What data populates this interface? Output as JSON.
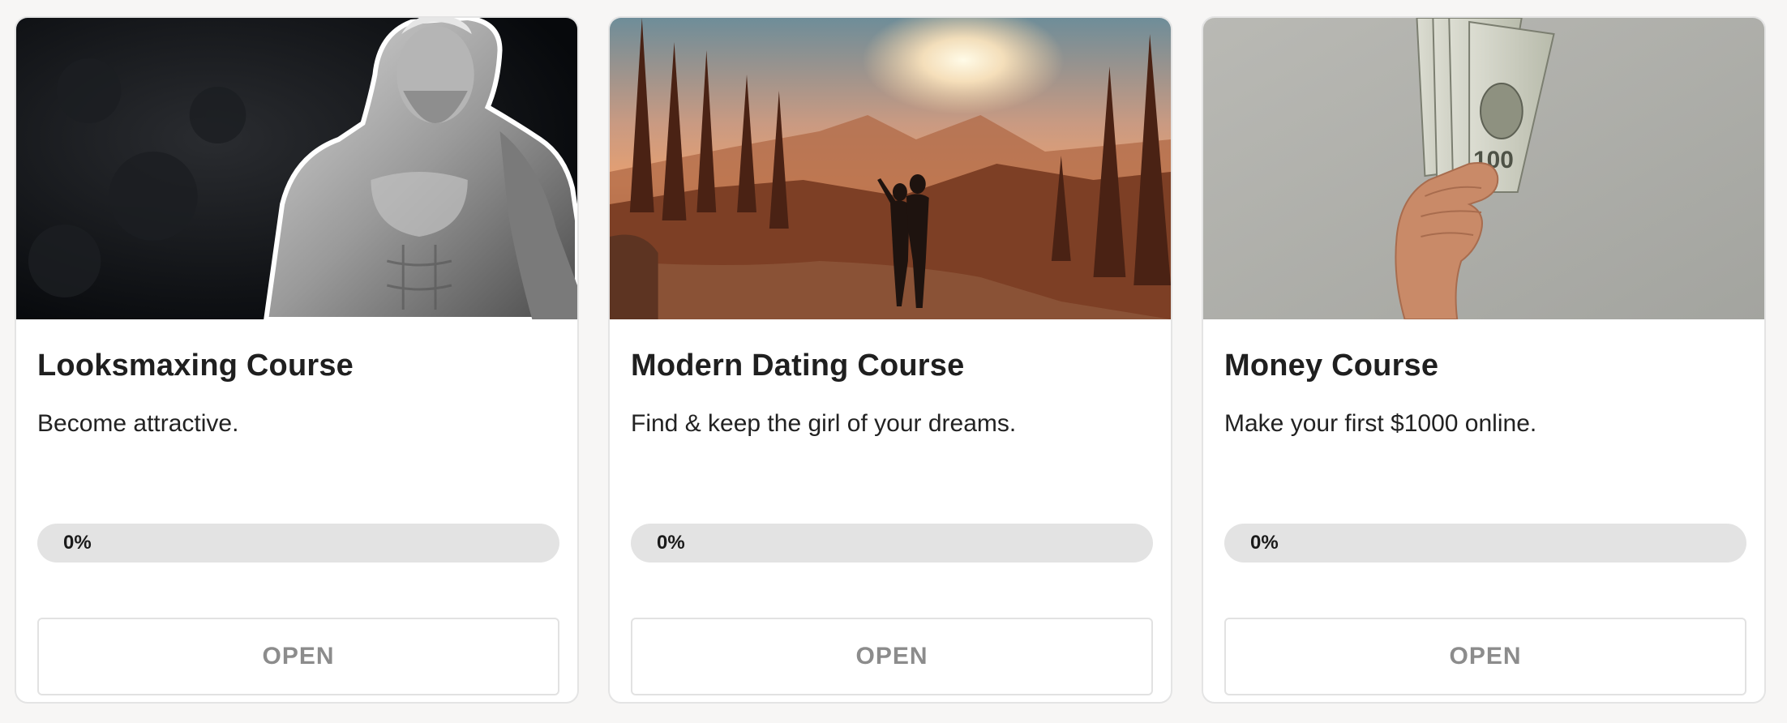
{
  "courses": [
    {
      "title": "Looksmaxing Course",
      "description": "Become attractive.",
      "progress": 0,
      "progress_label": "0%",
      "button_label": "OPEN",
      "image": "greek-statue-image"
    },
    {
      "title": "Modern Dating Course",
      "description": "Find & keep the girl of your dreams.",
      "progress": 0,
      "progress_label": "0%",
      "button_label": "OPEN",
      "image": "sunset-couple-image"
    },
    {
      "title": "Money Course",
      "description": "Make your first $1000 online.",
      "progress": 0,
      "progress_label": "0%",
      "button_label": "OPEN",
      "image": "hand-holding-cash-image"
    }
  ],
  "colors": {
    "page_background": "#f7f6f5",
    "card_background": "#ffffff",
    "card_border": "#e4e4e4",
    "progress_track": "#e3e3e3",
    "button_text": "#8c8c8c"
  }
}
